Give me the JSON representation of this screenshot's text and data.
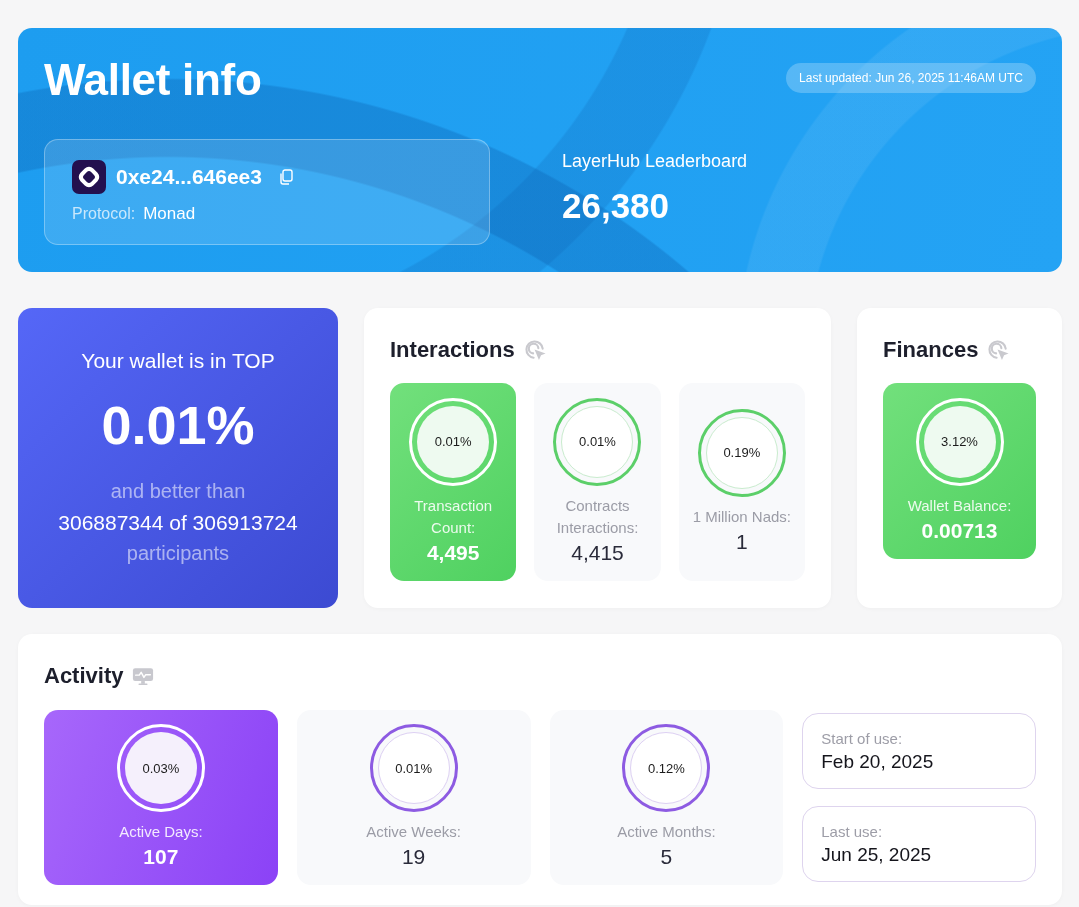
{
  "header": {
    "title": "Wallet info",
    "last_updated": "Last updated: Jun 26, 2025 11:46AM UTC",
    "wallet": {
      "address": "0xe24...646ee3",
      "protocol_label": "Protocol:",
      "protocol": "Monad"
    },
    "leaderboard": {
      "label": "LayerHub Leaderboard",
      "value": "26,380"
    }
  },
  "rank": {
    "heading": "Your wallet is in TOP",
    "percent": "0.01%",
    "summary": "and better than **306887344 of 306913724** participants"
  },
  "interactions": {
    "title": "Interactions",
    "tiles": [
      {
        "percent": "0.01%",
        "label": "Transaction Count:",
        "value": "4,495",
        "highlighted": true
      },
      {
        "percent": "0.01%",
        "label": "Contracts Interactions:",
        "value": "4,415",
        "highlighted": false
      },
      {
        "percent": "0.19%",
        "label": "1 Million Nads:",
        "value": "1",
        "highlighted": false
      }
    ]
  },
  "finances": {
    "title": "Finances",
    "tiles": [
      {
        "percent": "3.12%",
        "label": "Wallet Balance:",
        "value": "0.00713",
        "highlighted": true
      }
    ]
  },
  "activity": {
    "title": "Activity",
    "tiles": [
      {
        "percent": "0.03%",
        "label": "Active Days:",
        "value": "107",
        "highlighted": true
      },
      {
        "percent": "0.01%",
        "label": "Active Weeks:",
        "value": "19",
        "highlighted": false
      },
      {
        "percent": "0.12%",
        "label": "Active Months:",
        "value": "5",
        "highlighted": false
      }
    ],
    "dates": [
      {
        "label": "Start of use:",
        "value": "Feb 20, 2025"
      },
      {
        "label": "Last use:",
        "value": "Jun 25, 2025"
      }
    ]
  }
}
